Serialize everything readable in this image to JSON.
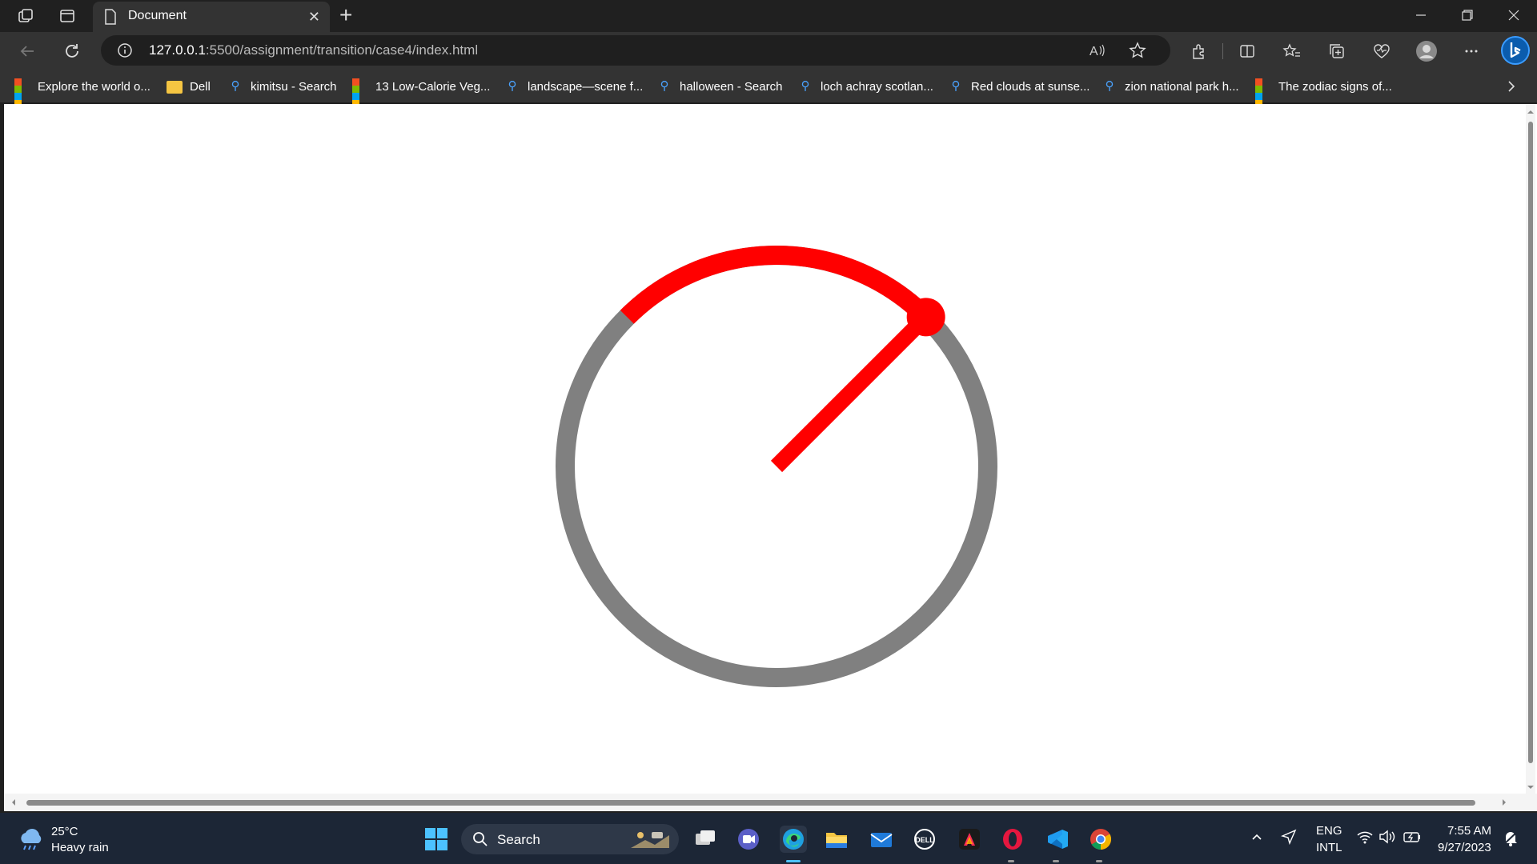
{
  "browser": {
    "tab_title": "Document",
    "url_host": "127.0.0.1",
    "url_path": ":5500/assignment/transition/case4/index.html",
    "new_tab_symbol": "+",
    "close_symbol": "✕",
    "read_aloud_label": "Á́"
  },
  "favorites": [
    {
      "label": "Explore the world o...",
      "icon": "microsoft-logo"
    },
    {
      "label": "Dell",
      "icon": "folder-icon"
    },
    {
      "label": "kimitsu - Search",
      "icon": "search-icon"
    },
    {
      "label": "13 Low-Calorie Veg...",
      "icon": "microsoft-logo"
    },
    {
      "label": "landscape—scene f...",
      "icon": "search-icon"
    },
    {
      "label": "halloween - Search",
      "icon": "search-icon"
    },
    {
      "label": "loch achray scotlan...",
      "icon": "search-icon"
    },
    {
      "label": "Red clouds at sunse...",
      "icon": "search-icon"
    },
    {
      "label": "zion national park h...",
      "icon": "search-icon"
    },
    {
      "label": "The zodiac signs of...",
      "icon": "microsoft-logo"
    }
  ],
  "gauge": {
    "track_color": "#808080",
    "progress_color": "#ff0000",
    "progress_start_deg": -45,
    "progress_end_deg": 45,
    "needle_deg": 45
  },
  "taskbar": {
    "weather_temp": "25°C",
    "weather_desc": "Heavy rain",
    "search_label": "Search",
    "lang_top": "ENG",
    "lang_bottom": "INTL",
    "time": "7:55 AM",
    "date": "9/27/2023"
  }
}
